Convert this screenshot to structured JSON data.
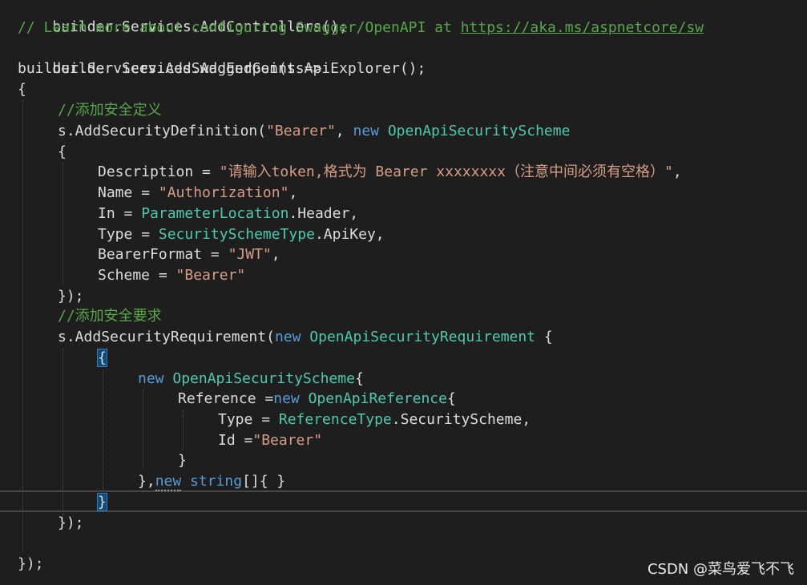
{
  "watermark": "CSDN @菜鸟爱飞不飞",
  "colors": {
    "background": "#1e1e1e",
    "keyword": "#569cd6",
    "type": "#4ec9b0",
    "string": "#d69d85",
    "comment": "#57a64a",
    "plain": "#dcdcdc"
  },
  "code": {
    "l1": [
      "builder.Services.AddControllers();"
    ],
    "l2": [
      "// Learn more about configuring Swagger/OpenAPI at ",
      "https://aka.ms/aspnetcore/sw"
    ],
    "l3": [
      "builder.Services.AddEndpointsApiExplorer();"
    ],
    "l4": [
      "builder.Services.AddSwaggerGen(",
      "s",
      " =>"
    ],
    "l5": [
      "{"
    ],
    "l6": [
      "//添加安全定义"
    ],
    "l7": [
      "s",
      ".AddSecurityDefinition(",
      "\"Bearer\"",
      ", ",
      "new",
      " ",
      "OpenApiSecurityScheme"
    ],
    "l8": [
      "{"
    ],
    "l9": [
      "Description",
      " = ",
      "\"请输入token,格式为 Bearer xxxxxxxx（注意中间必须有空格）\"",
      ","
    ],
    "l10": [
      "Name",
      " = ",
      "\"Authorization\"",
      ","
    ],
    "l11": [
      "In",
      " = ",
      "ParameterLocation",
      ".Header,"
    ],
    "l12": [
      "Type",
      " = ",
      "SecuritySchemeType",
      ".ApiKey,"
    ],
    "l13": [
      "BearerFormat",
      " = ",
      "\"JWT\"",
      ","
    ],
    "l14": [
      "Scheme",
      " = ",
      "\"Bearer\""
    ],
    "l15": [
      "});"
    ],
    "l16": [
      "//添加安全要求"
    ],
    "l17": [
      "s",
      ".AddSecurityRequirement(",
      "new",
      " ",
      "OpenApiSecurityRequirement",
      " {"
    ],
    "l18": [
      "{"
    ],
    "l19": [
      "new",
      " ",
      "OpenApiSecurityScheme",
      "{"
    ],
    "l20": [
      "Reference",
      " =",
      "new",
      " ",
      "OpenApiReference",
      "{"
    ],
    "l21": [
      "Type",
      " = ",
      "ReferenceType",
      ".SecurityScheme,"
    ],
    "l22": [
      "Id",
      " =",
      "\"Bearer\""
    ],
    "l23": [
      "}"
    ],
    "l24": [
      "},",
      "new",
      " ",
      "string",
      "[]{ }"
    ],
    "l25": [
      "}"
    ],
    "l26": [
      "});"
    ],
    "l27": [
      "});"
    ]
  }
}
